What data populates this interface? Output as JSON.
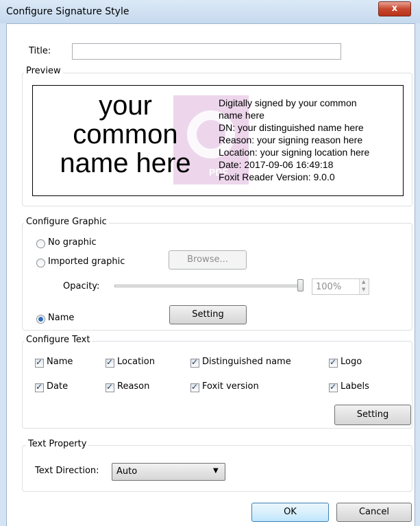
{
  "window": {
    "title": "Configure Signature Style",
    "close_label": "x"
  },
  "title_field": {
    "label": "Title:",
    "value": ""
  },
  "preview": {
    "group_label": "Preview",
    "name_lines": [
      "your",
      "common",
      "name here"
    ],
    "info_lines": [
      "Digitally signed by your common",
      "name here",
      "DN: your distinguished name here",
      "Reason: your signing reason here",
      "Location: your signing location here",
      "Date: 2017-09-06 16:49:18",
      "Foxit Reader Version: 9.0.0"
    ],
    "watermark_text": "PDF"
  },
  "configure_graphic": {
    "group_label": "Configure Graphic",
    "no_graphic": "No graphic",
    "imported_graphic": "Imported graphic",
    "browse_button": "Browse...",
    "opacity_label": "Opacity:",
    "opacity_value": "100%",
    "opacity_fraction": 1.0,
    "name_option": "Name",
    "setting_button": "Setting",
    "selected": "Name"
  },
  "configure_text": {
    "group_label": "Configure Text",
    "options": [
      {
        "label": "Name",
        "checked": true
      },
      {
        "label": "Location",
        "checked": true
      },
      {
        "label": "Distinguished name",
        "checked": true
      },
      {
        "label": "Logo",
        "checked": true
      },
      {
        "label": "Date",
        "checked": true
      },
      {
        "label": "Reason",
        "checked": true
      },
      {
        "label": "Foxit version",
        "checked": true
      },
      {
        "label": "Labels",
        "checked": true
      }
    ],
    "setting_button": "Setting"
  },
  "text_property": {
    "group_label": "Text Property",
    "direction_label": "Text Direction:",
    "direction_value": "Auto"
  },
  "footer": {
    "ok_button": "OK",
    "cancel_button": "Cancel"
  },
  "colors": {
    "accent": "#2f6fbe",
    "watermark": "#e7c9e6",
    "close_button": "#c7492f"
  }
}
